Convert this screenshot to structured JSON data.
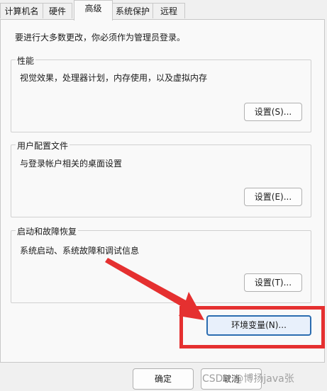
{
  "tabs": [
    "计算机名",
    "硬件",
    "高级",
    "系统保护",
    "远程"
  ],
  "active_tab": "高级",
  "notice": "要进行大多数更改，你必须作为管理员登录。",
  "groups": [
    {
      "title": "性能",
      "desc": "视觉效果，处理器计划，内存使用，以及虚拟内存",
      "button": "设置(S)..."
    },
    {
      "title": "用户配置文件",
      "desc": "与登录帐户相关的桌面设置",
      "button": "设置(E)..."
    },
    {
      "title": "启动和故障恢复",
      "desc": "系统启动、系统故障和调试信息",
      "button": "设置(T)..."
    }
  ],
  "env_button": "环境变量(N)...",
  "ok_button": "确定",
  "cancel_button": "取消",
  "watermark": "CSDN @博扬java张",
  "colors": {
    "highlight": "#e53030",
    "focus_border": "#2b6cb0"
  }
}
